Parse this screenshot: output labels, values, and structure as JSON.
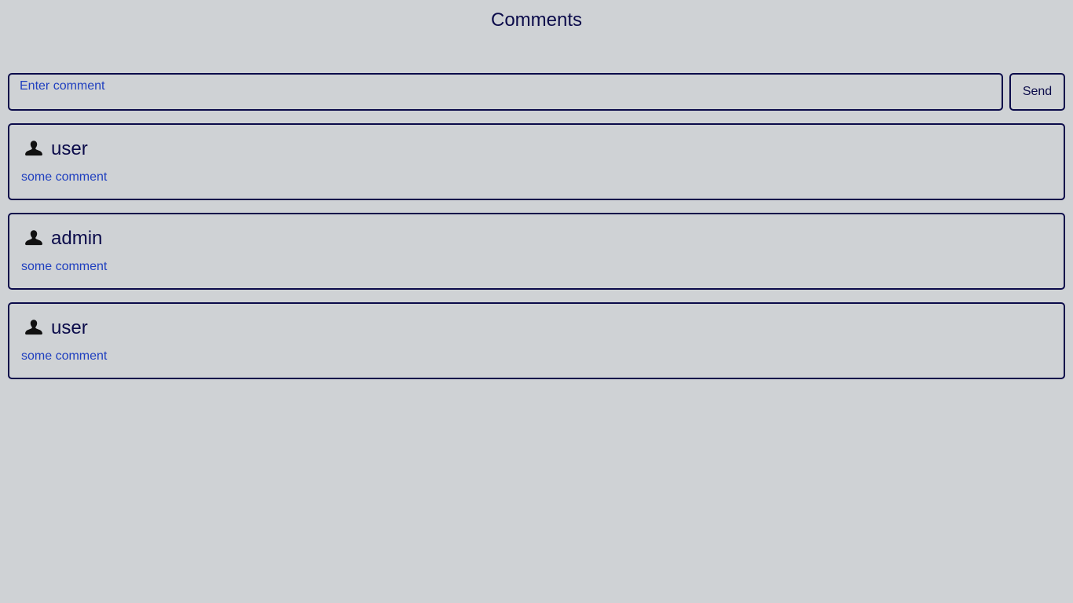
{
  "page": {
    "title": "Comments"
  },
  "composer": {
    "placeholder": "Enter comment",
    "value": "",
    "send_label": "Send"
  },
  "comments": [
    {
      "author": "user",
      "text": "some comment",
      "icon": "user-icon"
    },
    {
      "author": "admin",
      "text": "some comment",
      "icon": "user-icon"
    },
    {
      "author": "user",
      "text": "some comment",
      "icon": "user-icon"
    }
  ],
  "colors": {
    "background": "#cfd2d5",
    "border": "#0b0b4a",
    "heading_text": "#0b0b4a",
    "body_text": "#1f3fbf"
  }
}
